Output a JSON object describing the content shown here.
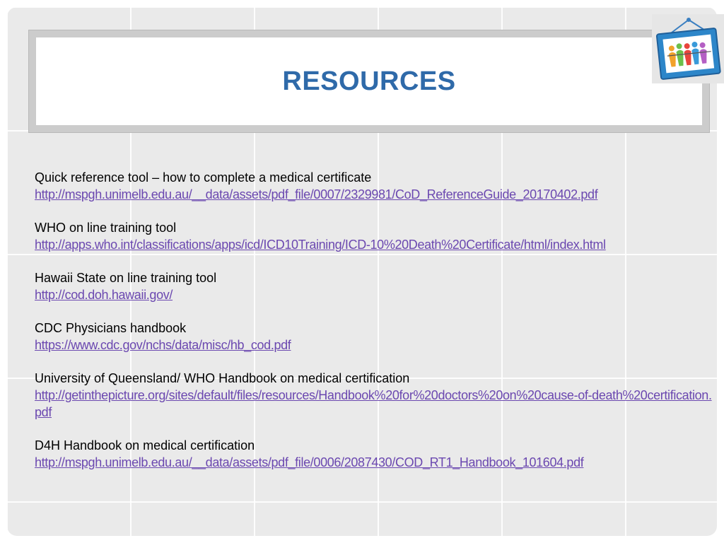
{
  "slide": {
    "title": "RESOURCES",
    "logo_icon": "children-picture-frame-icon"
  },
  "resources": [
    {
      "label": "Quick reference tool – how to complete a medical certificate",
      "url": "http://mspgh.unimelb.edu.au/__data/assets/pdf_file/0007/2329981/CoD_ReferenceGuide_20170402.pdf"
    },
    {
      "label": "WHO on line training tool",
      "url": "http://apps.who.int/classifications/apps/icd/ICD10Training/ICD-10%20Death%20Certificate/html/index.html"
    },
    {
      "label": "Hawaii State on line training tool",
      "url": "http://cod.doh.hawaii.gov/"
    },
    {
      "label": "CDC Physicians handbook",
      "url": "https://www.cdc.gov/nchs/data/misc/hb_cod.pdf"
    },
    {
      "label": "University of Queensland/ WHO Handbook on medical certification",
      "url": "http://getinthepicture.org/sites/default/files/resources/Handbook%20for%20doctors%20on%20cause-of-death%20certification.pdf"
    },
    {
      "label": "D4H Handbook on medical certification",
      "url": "http://mspgh.unimelb.edu.au/__data/assets/pdf_file/0006/2087430/COD_RT1_Handbook_101604.pdf"
    }
  ],
  "colors": {
    "title": "#2f6aa9",
    "link": "#6b48b0",
    "background": "#eaeaea"
  }
}
